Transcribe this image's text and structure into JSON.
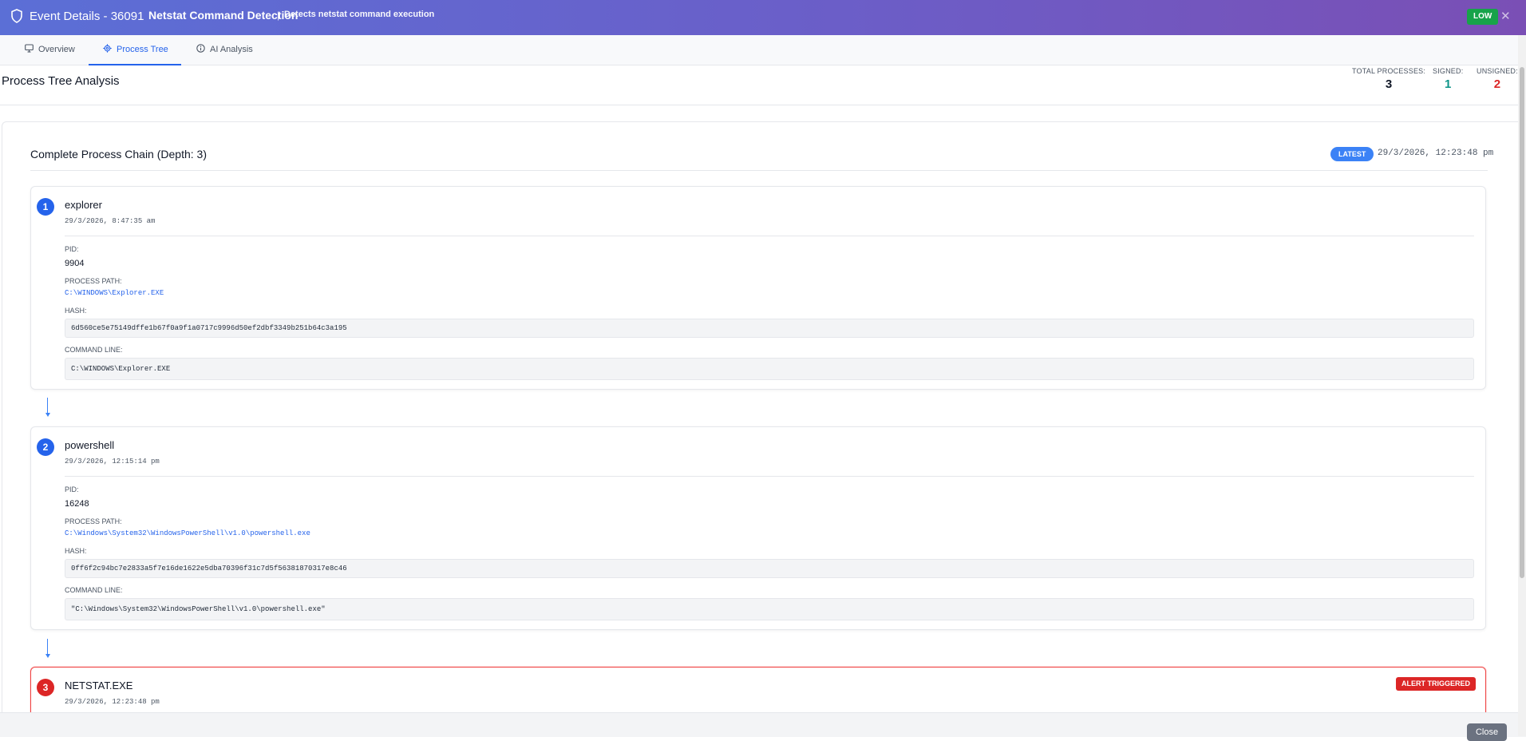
{
  "header": {
    "event_title": "Event Details - 36091",
    "rule_name": "Netstat Command Detection",
    "separator": "|",
    "rule_description": "Detects netstat command execution",
    "severity": "LOW",
    "close_glyph": "✕",
    "color": "#667eea"
  },
  "tabs": [
    {
      "label": "Overview",
      "icon": "monitor-icon"
    },
    {
      "label": "Process Tree",
      "icon": "gear-icon",
      "active": true
    },
    {
      "label": "AI Analysis",
      "icon": "info-icon"
    }
  ],
  "summary": {
    "title": "Process Tree Analysis",
    "stats": [
      {
        "label": "TOTAL PROCESSES:",
        "value": "3",
        "color": "#111827"
      },
      {
        "label": "SIGNED:",
        "value": "1",
        "color": "#0d9488"
      },
      {
        "label": "UNSIGNED:",
        "value": "2",
        "color": "#dc2626"
      }
    ]
  },
  "chain": {
    "title": "Complete Process Chain (Depth: 3)",
    "latest_badge": "LATEST",
    "latest_time": "29/3/2026, 12:23:48 pm"
  },
  "field_labels": {
    "pid": "PID:",
    "process_path": "PROCESS PATH:",
    "hash": "HASH:",
    "command_line": "COMMAND LINE:"
  },
  "processes": [
    {
      "index": "1",
      "name": "explorer",
      "time": "29/3/2026, 8:47:35 am",
      "pid": "9904",
      "path": "C:\\WINDOWS\\Explorer.EXE",
      "hash": "6d560ce5e75149dffe1b67f0a9f1a0717c9996d50ef2dbf3349b251b64c3a195",
      "command_line": "C:\\WINDOWS\\Explorer.EXE"
    },
    {
      "index": "2",
      "name": "powershell",
      "time": "29/3/2026, 12:15:14 pm",
      "pid": "16248",
      "path": "C:\\Windows\\System32\\WindowsPowerShell\\v1.0\\powershell.exe",
      "hash": "0ff6f2c94bc7e2833a5f7e16de1622e5dba70396f31c7d5f56381870317e8c46",
      "command_line": "\"C:\\Windows\\System32\\WindowsPowerShell\\v1.0\\powershell.exe\""
    },
    {
      "index": "3",
      "name": "NETSTAT.EXE",
      "time": "29/3/2026, 12:23:48 pm",
      "alert_badge": "ALERT TRIGGERED"
    }
  ],
  "footer": {
    "close_label": "Close"
  }
}
